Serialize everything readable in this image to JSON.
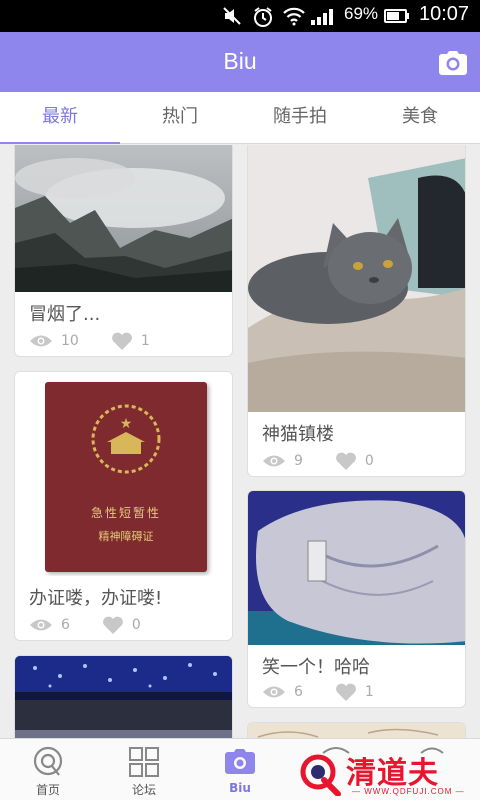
{
  "status_bar": {
    "battery_percent": "69%",
    "time": "10:07",
    "icons": [
      "mute-icon",
      "alarm-icon",
      "wifi-icon",
      "signal-icon",
      "battery-icon"
    ]
  },
  "app_bar": {
    "title": "Biu",
    "camera_icon": "camera-icon"
  },
  "tabs": [
    {
      "label": "最新",
      "active": true
    },
    {
      "label": "热门",
      "active": false
    },
    {
      "label": "随手拍",
      "active": false
    },
    {
      "label": "美食",
      "active": false
    }
  ],
  "posts": [
    {
      "caption": "冒烟了...",
      "views": "10",
      "likes": "1",
      "image": "misty-mountains-photo"
    },
    {
      "caption": "神猫镇楼",
      "views": "9",
      "likes": "0",
      "image": "grey-cat-photo"
    },
    {
      "caption": "办证喽，办证喽!",
      "views": "6",
      "likes": "0",
      "image": "red-certificate-photo",
      "certificate_text": {
        "line1": "急性短暂性",
        "line2": "精神障碍证"
      }
    },
    {
      "caption": "笑一个！哈哈",
      "views": "6",
      "likes": "1",
      "image": "smiling-surface-photo"
    },
    {
      "caption": "",
      "image": "blue-lights-photo"
    },
    {
      "caption": "",
      "image": "sketch-photo"
    }
  ],
  "bottom_nav": [
    {
      "label": "首页",
      "icon": "home-q-icon",
      "active": false
    },
    {
      "label": "论坛",
      "icon": "grid-icon",
      "active": false
    },
    {
      "label": "Biu",
      "icon": "camera-icon",
      "active": true
    },
    {
      "label": "",
      "icon": "message-icon",
      "active": false
    },
    {
      "label": "",
      "icon": "profile-icon",
      "active": false
    }
  ],
  "watermark": {
    "text": "清道夫",
    "url": "— WWW.QDFUJI.COM —"
  },
  "colors": {
    "accent": "#8e86ec",
    "active_tab": "#7d78e0",
    "watermark": "#e8152e"
  }
}
